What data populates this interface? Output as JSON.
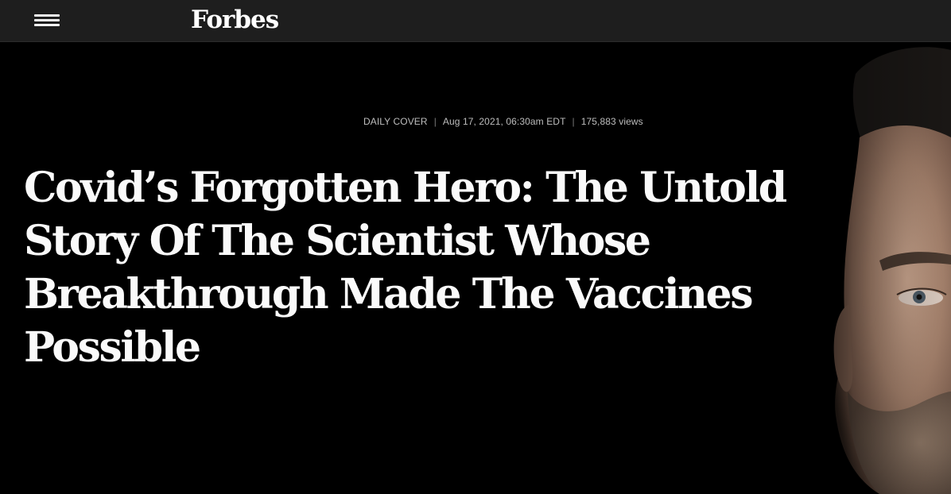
{
  "header": {
    "menu_icon": "hamburger-menu-icon",
    "logo_text": "Forbes"
  },
  "article": {
    "section": "DAILY COVER",
    "date": "Aug 17, 2021, 06:30am EDT",
    "views": "175,883 views",
    "headline": "Covid’s Forgotten Hero: The Untold Story Of The Scientist Whose Breakthrough Made The Vaccines Possible"
  },
  "colors": {
    "background": "#000000",
    "header_bar": "#1e1e1e",
    "headline_text": "#fafafa",
    "meta_text": "#bdbdbd"
  }
}
